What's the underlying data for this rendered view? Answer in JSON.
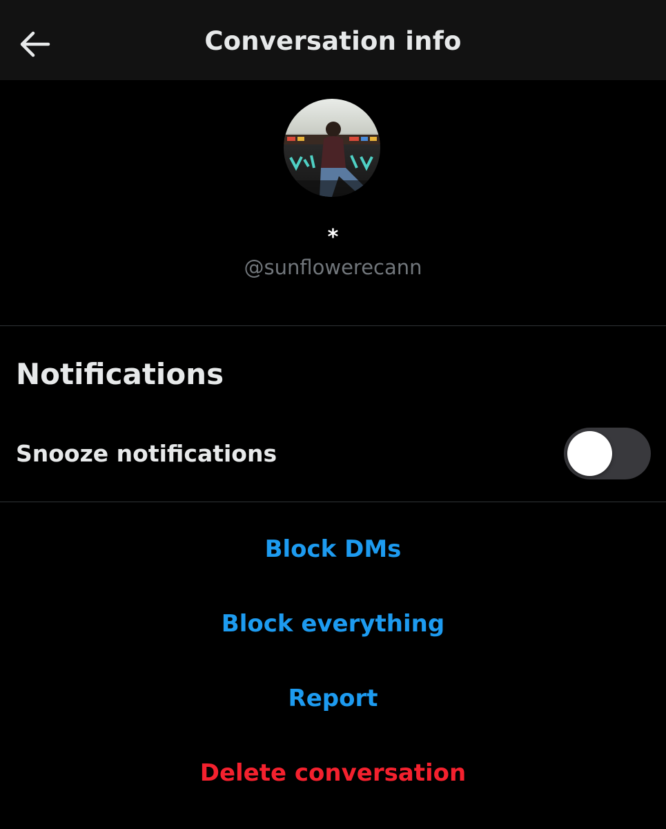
{
  "header": {
    "back_icon": "arrow-left-icon",
    "title": "Conversation info"
  },
  "profile": {
    "display_name": "*",
    "handle": "@sunflowerecann"
  },
  "notifications": {
    "section_title": "Notifications",
    "snooze_label": "Snooze notifications",
    "snooze_enabled": false
  },
  "actions": {
    "block_dms": "Block DMs",
    "block_everything": "Block everything",
    "report": "Report",
    "delete_conversation": "Delete conversation"
  },
  "colors": {
    "background": "#000000",
    "header_background": "#121212",
    "link_blue": "#1d9bf0",
    "danger_red": "#f4212e",
    "secondary_text": "#71767b",
    "toggle_off_track": "#39393d"
  }
}
